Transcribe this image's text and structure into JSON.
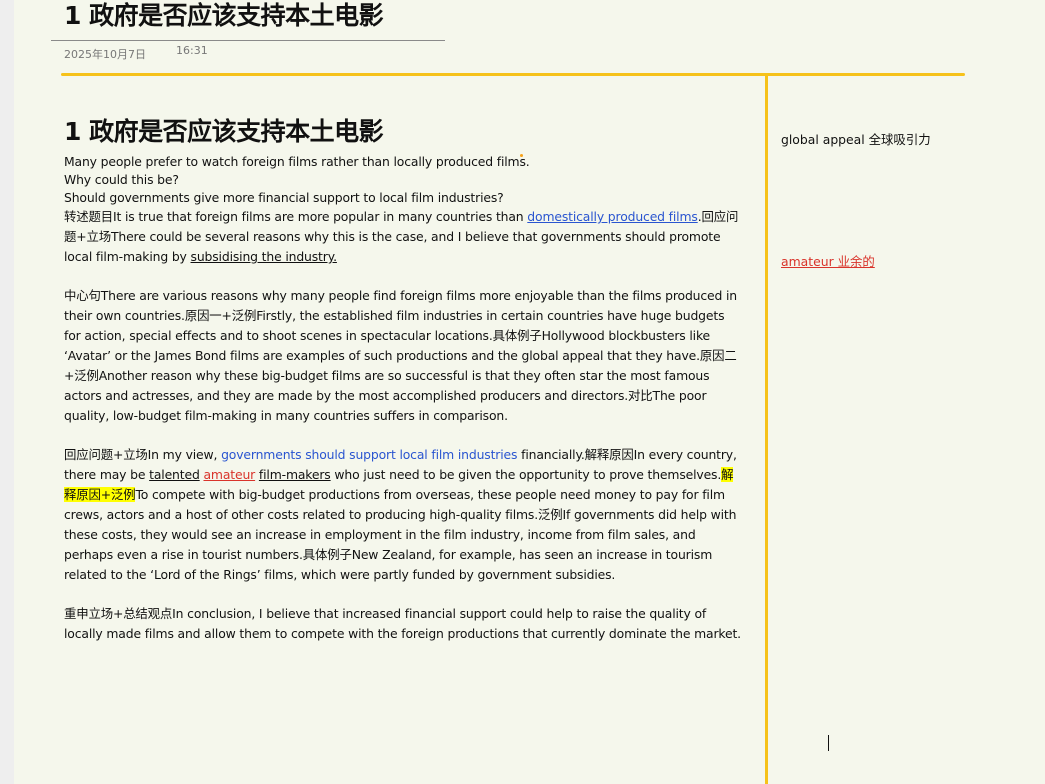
{
  "page": {
    "title": "1 政府是否应该支持本土电影",
    "date": "2025年10月7日",
    "time": "16:31"
  },
  "content": {
    "heading": "1 政府是否应该支持本土电影",
    "intro": [
      "Many people prefer to watch foreign films rather than locally produced films.",
      "Why could this be?",
      "Should governments give more financial support to local film industries?"
    ],
    "p1": {
      "s1": "转述题目It is true that foreign films are more popular in many countries than ",
      "link1": "domestically produced films",
      "s2": ".回应问题+立场There could be several reasons why this is the case, and I believe that governments should promote local film-making by ",
      "link2": "subsidising the industry."
    },
    "p2": "中心句There are various reasons why many people find foreign films more enjoyable than the films produced in their own countries.原因一+泛例Firstly, the established film industries in certain countries have huge budgets for action, special effects and to shoot scenes in spectacular locations.具体例子Hollywood blockbusters like ‘Avatar’ or the James Bond films are examples of such productions and the global appeal that they have.原因二+泛例Another reason why these big-budget films are so successful is that they often star the most famous actors and actresses, and they are made by the most accomplished producers and directors.对比The poor quality, low-budget film-making in many countries suffers in comparison.",
    "p3": {
      "s1": "回应问题+立场In my view, ",
      "blue": "governments should support local film industries",
      "s2": " financially.解释原因In every country, there may be ",
      "talented": "talented",
      "amateur": "amateur",
      "filmmakers": "film-makers",
      "s3": " who just need to be given the opportunity to prove themselves.",
      "highlight": "解释原因+泛例",
      "s4": "To compete with big-budget productions from overseas, these people need money to pay for film crews, actors and a host of other costs related to producing high-quality films.泛例If governments did help with these costs, they would see an increase in employment in the film industry, income from film sales, and perhaps even a rise in tourist numbers.具体例子New Zealand, for example, has seen an increase in tourism related to the ‘Lord of the Rings’ films, which were partly funded by government subsidies."
    },
    "p4": "重申立场+总结观点In conclusion, I believe that increased financial support could help to raise the quality of locally made films and allow them to compete with the foreign productions that currently dominate the market."
  },
  "notes": {
    "note1": "global appeal 全球吸引力",
    "note2": "amateur 业余的"
  },
  "colors": {
    "accent_line": "#f6c21a",
    "link": "#2a55d0",
    "red_note": "#d9342b",
    "highlight": "#ffff00",
    "page_bg": "#f5f7ec"
  }
}
